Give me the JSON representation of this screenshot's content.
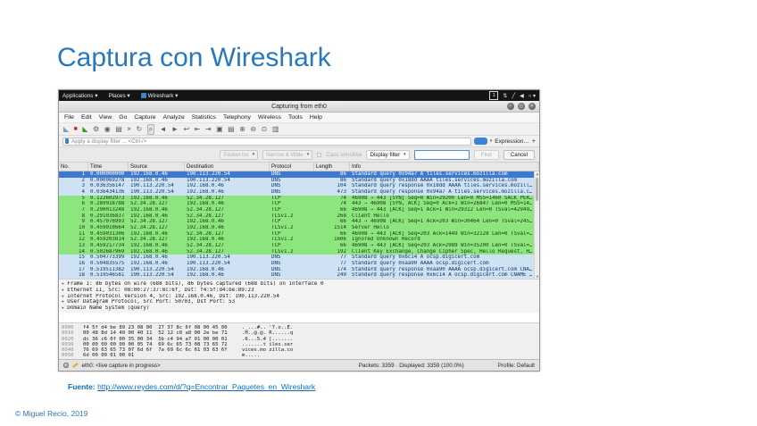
{
  "slide": {
    "title": "Captura con Wireshark",
    "source_label": "Fuente:",
    "source_url": "http://www.reydes.com/d/?q=Encontrar_Paquetes_en_Wireshark",
    "copyright": "© Miguel Recio, 2019"
  },
  "colors": {
    "title_blue": "#2878be",
    "link_blue": "#0f6cbd",
    "selected_row": "#3e79cf",
    "dns_row": "#cfe2f3",
    "tcp_row": "#8ce57d",
    "panel_black": "#151515"
  },
  "panel": {
    "applications_label": "Applications ▾",
    "places_label": "Places ▾",
    "wireshark_label": "Wireshark ▾",
    "workspace": "1",
    "icons": [
      {
        "name": "network-icon",
        "glyph": "⇅"
      },
      {
        "name": "input-method-icon",
        "glyph": "╱"
      },
      {
        "name": "volume-icon",
        "glyph": "◀"
      },
      {
        "name": "power-icon",
        "glyph": "○ ▾"
      }
    ]
  },
  "window": {
    "title": "Capturing from eth0",
    "window_buttons": [
      {
        "name": "minimize-button",
        "glyph": "−"
      },
      {
        "name": "maximize-button",
        "glyph": "◻"
      },
      {
        "name": "close-button",
        "glyph": "×"
      }
    ],
    "menu_items": [
      {
        "name": "menu-file",
        "label": "File"
      },
      {
        "name": "menu-edit",
        "label": "Edit"
      },
      {
        "name": "menu-view",
        "label": "View"
      },
      {
        "name": "menu-go",
        "label": "Go"
      },
      {
        "name": "menu-capture",
        "label": "Capture"
      },
      {
        "name": "menu-analyze",
        "label": "Analyze"
      },
      {
        "name": "menu-statistics",
        "label": "Statistics"
      },
      {
        "name": "menu-telephony",
        "label": "Telephony"
      },
      {
        "name": "menu-wireless",
        "label": "Wireless"
      },
      {
        "name": "menu-tools",
        "label": "Tools"
      },
      {
        "name": "menu-help",
        "label": "Help"
      }
    ],
    "toolbar_icons": [
      {
        "name": "start-capture-icon",
        "glyph": "◣",
        "cls": "k-start"
      },
      {
        "name": "stop-capture-icon",
        "glyph": "■",
        "cls": "k-stop"
      },
      {
        "name": "restart-capture-icon",
        "glyph": "◣",
        "cls": "k-restart"
      },
      {
        "name": "capture-options-icon",
        "glyph": "⚙",
        "cls": ""
      },
      {
        "name": "open-file-icon",
        "glyph": "◉",
        "cls": ""
      },
      {
        "name": "save-file-icon",
        "glyph": "▤",
        "cls": ""
      },
      {
        "name": "close-capture-icon",
        "glyph": "×",
        "cls": ""
      },
      {
        "name": "reload-icon",
        "glyph": "↻",
        "cls": ""
      },
      {
        "name": "find-packet-icon",
        "glyph": "⌕",
        "cls": "k-find"
      },
      {
        "name": "go-back-icon",
        "glyph": "◄",
        "cls": ""
      },
      {
        "name": "go-forward-icon",
        "glyph": "►",
        "cls": ""
      },
      {
        "name": "go-to-packet-icon",
        "glyph": "↩",
        "cls": ""
      },
      {
        "name": "first-packet-icon",
        "glyph": "⇤",
        "cls": ""
      },
      {
        "name": "last-packet-icon",
        "glyph": "⇥",
        "cls": ""
      },
      {
        "name": "auto-scroll-icon",
        "glyph": "▣",
        "cls": ""
      },
      {
        "name": "colorize-icon",
        "glyph": "▤",
        "cls": ""
      },
      {
        "name": "zoom-in-icon",
        "glyph": "⊕",
        "cls": ""
      },
      {
        "name": "zoom-out-icon",
        "glyph": "⊖",
        "cls": ""
      },
      {
        "name": "zoom-reset-icon",
        "glyph": "⊙",
        "cls": ""
      },
      {
        "name": "resize-columns-icon",
        "glyph": "▥",
        "cls": ""
      }
    ],
    "filter": {
      "placeholder": "Apply a display filter ... <Ctrl-/>",
      "expression_label": "Expression…",
      "plus_label": "+"
    },
    "find_bar": {
      "packet_list_label": "Packet list",
      "narrow_wide_label": "Narrow & Wide",
      "case_sensitive_label": "Case sensitive",
      "display_filter_label": "Display filter",
      "search_value": "",
      "find_label": "Find",
      "cancel_label": "Cancel"
    },
    "columns": [
      "No.",
      "Time",
      "Source",
      "Destination",
      "Protocol",
      "Length",
      "Info"
    ],
    "packets": [
      {
        "name": "packet-row-1",
        "no": "1",
        "time": "0.000000000",
        "src": "192.168.0.46",
        "dst": "190.113.220.54",
        "proto": "DNS",
        "len": "86",
        "info": "Standard query 0x94a7 A tiles.services.mozilla.com",
        "cls": "sel"
      },
      {
        "name": "packet-row-2",
        "no": "2",
        "time": "0.000069278",
        "src": "192.168.0.46",
        "dst": "190.113.220.54",
        "proto": "DNS",
        "len": "86",
        "info": "Standard query 0x18dd AAAA tiles.services.mozilla.com",
        "cls": "dns"
      },
      {
        "name": "packet-row-3",
        "no": "3",
        "time": "0.036356147",
        "src": "190.113.220.54",
        "dst": "192.168.0.46",
        "proto": "DNS",
        "len": "104",
        "info": "Standard query response 0x18dd AAAA tiles.services.mozill…",
        "cls": "dns"
      },
      {
        "name": "packet-row-4",
        "no": "4",
        "time": "0.036434136",
        "src": "190.113.220.54",
        "dst": "192.168.0.46",
        "proto": "DNS",
        "len": "473",
        "info": "Standard query response 0x94a7 A tiles.services.mozilla.c…",
        "cls": "dns"
      },
      {
        "name": "packet-row-5",
        "no": "5",
        "time": "0.122602973",
        "src": "192.168.0.46",
        "dst": "52.34.28.127",
        "proto": "TCP",
        "len": "74",
        "info": "46908 → 443 [SYN] Seq=0 Win=29200 Len=0 MSS=1460 SACK_PER…",
        "cls": "tcp"
      },
      {
        "name": "packet-row-6",
        "no": "6",
        "time": "0.289918788",
        "src": "52.34.28.127",
        "dst": "192.168.0.46",
        "proto": "TCP",
        "len": "74",
        "info": "443 → 46908 [SYN, ACK] Seq=0 Ack=1 Win=26847 Len=0 MSS=14…",
        "cls": "tcp"
      },
      {
        "name": "packet-row-7",
        "no": "7",
        "time": "0.290013248",
        "src": "192.168.0.46",
        "dst": "52.34.28.127",
        "proto": "TCP",
        "len": "66",
        "info": "46908 → 443 [ACK] Seq=1 Ack=1 Win=29312 Len=0 TSval=42949…",
        "cls": "tcp"
      },
      {
        "name": "packet-row-8",
        "no": "8",
        "time": "0.291036837",
        "src": "192.168.0.46",
        "dst": "52.34.28.127",
        "proto": "TLSv1.2",
        "len": "268",
        "info": "Client Hello",
        "cls": "tcp"
      },
      {
        "name": "packet-row-9",
        "no": "9",
        "time": "0.457076993",
        "src": "52.34.28.127",
        "dst": "192.168.0.46",
        "proto": "TCP",
        "len": "66",
        "info": "443 → 46908 [ACK] Seq=1 Ack=203 Win=30464 Len=0 TSval=245…",
        "cls": "tcp"
      },
      {
        "name": "packet-row-10",
        "no": "10",
        "time": "0.459010664",
        "src": "52.34.28.127",
        "dst": "192.168.0.46",
        "proto": "TLSv1.2",
        "len": "1514",
        "info": "Server Hello",
        "cls": "tcp"
      },
      {
        "name": "packet-row-11",
        "no": "11",
        "time": "0.459031306",
        "src": "192.168.0.46",
        "dst": "52.34.28.127",
        "proto": "TCP",
        "len": "66",
        "info": "46908 → 443 [ACK] Seq=203 Ack=1449 Win=32128 Len=0 TSval=…",
        "cls": "tcp"
      },
      {
        "name": "packet-row-12",
        "no": "12",
        "time": "0.459203814",
        "src": "52.34.28.127",
        "dst": "192.168.0.46",
        "proto": "TLSv1.2",
        "len": "1606",
        "info": "Ignored Unknown Record",
        "cls": "tcp"
      },
      {
        "name": "packet-row-13",
        "no": "13",
        "time": "0.459217734",
        "src": "192.168.0.46",
        "dst": "52.34.28.127",
        "proto": "TCP",
        "len": "66",
        "info": "46908 → 443 [ACK] Seq=203 Ack=2989 Win=35200 Len=0 TSval=…",
        "cls": "tcp"
      },
      {
        "name": "packet-row-14",
        "no": "14",
        "time": "0.502687969",
        "src": "192.168.0.46",
        "dst": "52.34.28.127",
        "proto": "TLSv1.2",
        "len": "192",
        "info": "Client Key Exchange, Change Cipher Spec, Hello Request, H…",
        "cls": "tcp"
      },
      {
        "name": "packet-row-15",
        "no": "15",
        "time": "0.504773399",
        "src": "192.168.0.46",
        "dst": "190.113.220.54",
        "proto": "DNS",
        "len": "77",
        "info": "Standard query 0x6c14 A ocsp.digicert.com",
        "cls": "dns"
      },
      {
        "name": "packet-row-16",
        "no": "16",
        "time": "0.504835575",
        "src": "192.168.0.46",
        "dst": "190.113.220.54",
        "proto": "DNS",
        "len": "77",
        "info": "Standard query 0xaa90 AAAA ocsp.digicert.com",
        "cls": "dns"
      },
      {
        "name": "packet-row-17",
        "no": "17",
        "time": "0.519511382",
        "src": "190.113.220.54",
        "dst": "192.168.0.46",
        "proto": "DNS",
        "len": "174",
        "info": "Standard query response 0xaa90 AAAA ocsp.digicert.com CNA…",
        "cls": "dns"
      },
      {
        "name": "packet-row-18",
        "no": "18",
        "time": "0.519546581",
        "src": "190.113.220.54",
        "dst": "192.168.0.46",
        "proto": "DNS",
        "len": "249",
        "info": "Standard query response 0x6c14 A ocsp.digicert.com CNAME …",
        "cls": "dns"
      }
    ],
    "details": [
      "Frame 1: 86 bytes on wire (688 bits), 86 bytes captured (688 bits) on interface 0",
      "Ethernet II, Src: 08:00:27:37:8c:6f, Dst: f4:5f:d4:be:89:23",
      "Internet Protocol Version 4, Src: 192.168.0.46, Dst: 190.113.220.54",
      "User Datagram Protocol, Src Port: 50703, Dst Port: 53",
      "Domain Name System (query)"
    ],
    "hex_dump": [
      {
        "off": "0000",
        "hex": "f4 5f d4 be 89 23 08 00  27 37 8c 6f 08 00 45 00",
        "ascii": "._...#.. '7.o..E."
      },
      {
        "off": "0010",
        "hex": "00 48 8d 14 40 00 40 11  52 12 c0 a8 00 2e be 71",
        "ascii": ".H..@.@. R......q"
      },
      {
        "off": "0020",
        "hex": "dc 36 c6 0f 00 35 00 34  5b c4 94 a7 01 00 00 01",
        "ascii": ".6...5.4 [......."
      },
      {
        "off": "0030",
        "hex": "00 00 00 00 00 00 05 74  69 6c 65 73 08 73 65 72",
        "ascii": ".......t iles.ser"
      },
      {
        "off": "0040",
        "hex": "76 69 63 65 73 07 6d 6f  7a 69 6c 6c 61 03 63 6f",
        "ascii": "vices.mo zilla.co"
      },
      {
        "off": "0050",
        "hex": "6d 00 00 01 00 01",
        "ascii": "m....."
      }
    ],
    "status": {
      "capture_info": "eth0: <live capture in progress>",
      "packets_info": "Packets: 3359 · Displayed: 3359 (100.0%)",
      "profile_info": "Profile: Default"
    }
  }
}
